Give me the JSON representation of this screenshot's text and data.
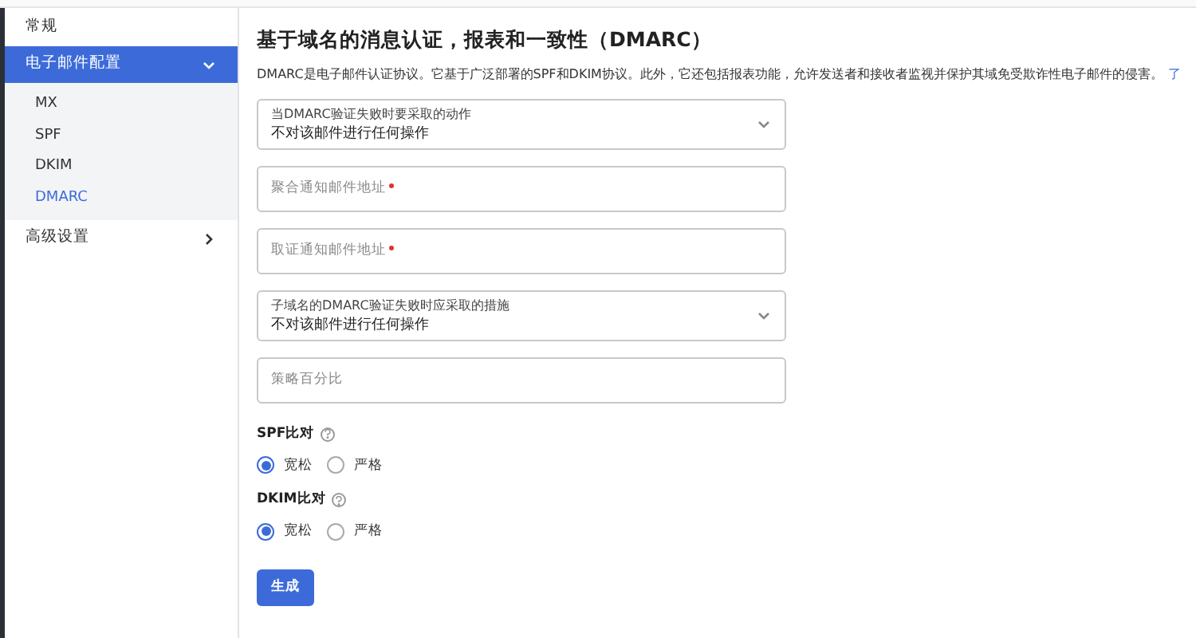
{
  "sidebar": {
    "items": [
      {
        "label": "常规",
        "selected": false
      },
      {
        "label": "电子邮件配置",
        "selected": true,
        "expanded": true,
        "children": [
          {
            "label": "MX",
            "selected": false
          },
          {
            "label": "SPF",
            "selected": false
          },
          {
            "label": "DKIM",
            "selected": false
          },
          {
            "label": "DMARC",
            "selected": true
          }
        ]
      },
      {
        "label": "高级设置",
        "selected": false,
        "expanded": false
      }
    ]
  },
  "main": {
    "title": "基于域名的消息认证，报表和一致性（DMARC）",
    "description": "DMARC是电子邮件认证协议。它基于广泛部署的SPF和DKIM协议。此外，它还包括报表功能，允许发送者和接收者监视并保护其域免受欺诈性电子邮件的侵害。",
    "link": "了",
    "fields": [
      {
        "kind": "select",
        "label": "当DMARC验证失败时要采取的动作",
        "value": "不对该邮件进行任何操作"
      },
      {
        "kind": "input",
        "placeholder": "聚合通知邮件地址",
        "required": true
      },
      {
        "kind": "input",
        "placeholder": "取证通知邮件地址",
        "required": true
      },
      {
        "kind": "select",
        "label": "子域名的DMARC验证失败时应采取的措施",
        "value": "不对该邮件进行任何操作"
      },
      {
        "kind": "input",
        "placeholder": "策略百分比",
        "required": false
      }
    ],
    "radio_groups": [
      {
        "label": "SPF比对",
        "options": [
          {
            "label": "宽松",
            "selected": true
          },
          {
            "label": "严格",
            "selected": false
          }
        ]
      },
      {
        "label": "DKIM比对",
        "options": [
          {
            "label": "宽松",
            "selected": true
          },
          {
            "label": "严格",
            "selected": false
          }
        ]
      }
    ],
    "button": "生成"
  }
}
